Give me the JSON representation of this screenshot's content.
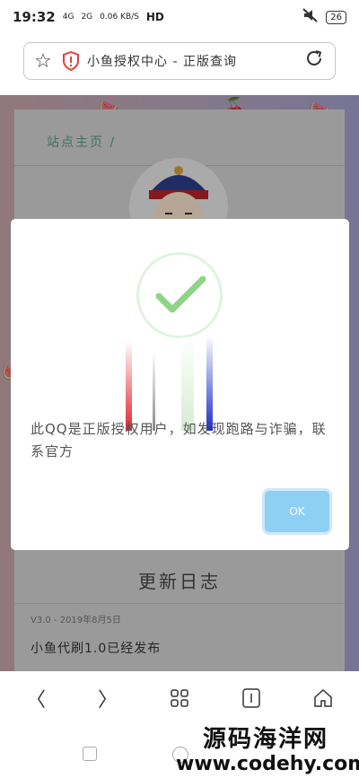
{
  "status": {
    "time": "19:32",
    "signal1": "4G",
    "signal2": "2G",
    "speed": "0.06 KB/S",
    "network": "HD",
    "battery": "26"
  },
  "browser": {
    "title": "小鱼授权中心 - 正版查询"
  },
  "page": {
    "breadcrumb": "站点主页 /",
    "update_title": "更新日志",
    "update_version": "V3.0 - 2019年8月5日",
    "update_text": "小鱼代刷1.0已经发布"
  },
  "dialog": {
    "message": "此QQ是正版授权用户，如发现跑路与诈骗，联系官方",
    "ok_label": "OK"
  },
  "watermark": {
    "line1": "源码海洋网",
    "line2": "www.codehy.com"
  },
  "colors": {
    "check": "#8fd486",
    "ok_button": "#8dd0f3",
    "breadcrumb": "#5a9c8c"
  }
}
